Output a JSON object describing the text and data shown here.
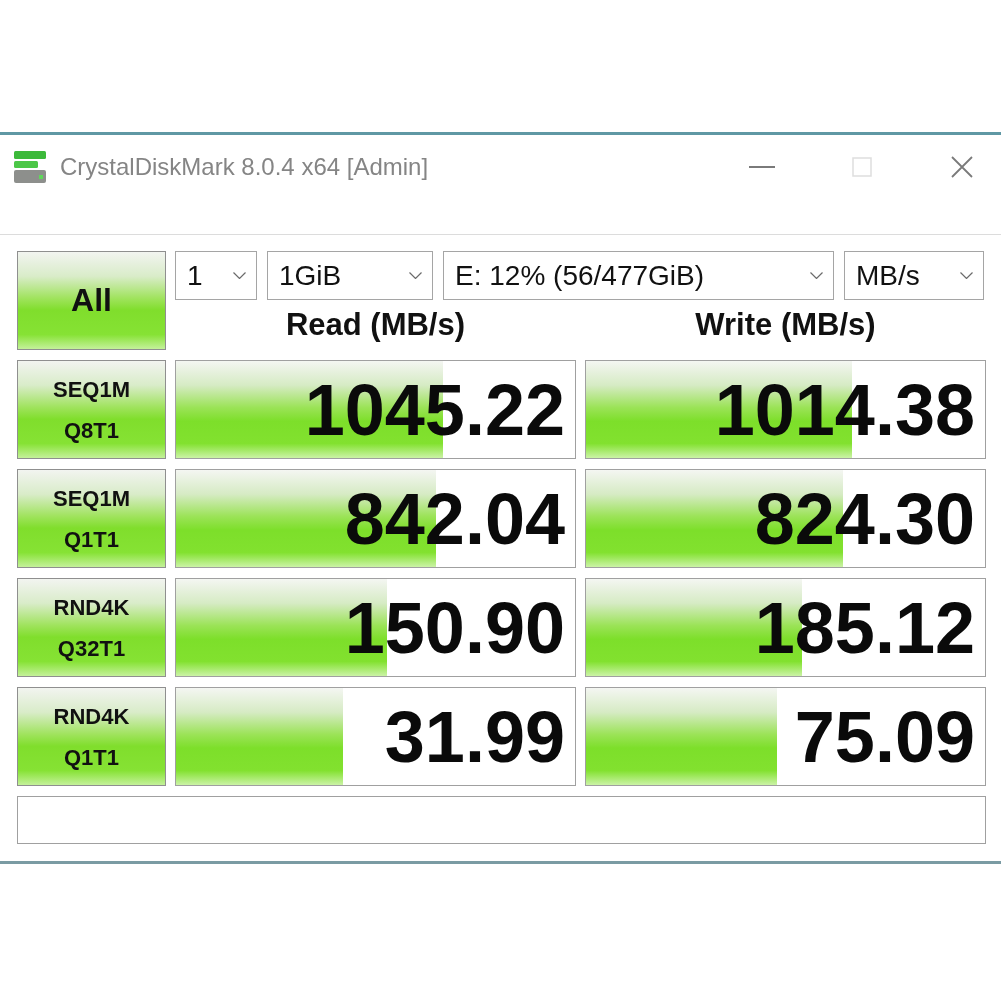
{
  "window": {
    "title": "CrystalDiskMark 8.0.4 x64 [Admin]",
    "buttons": [
      {
        "kind": "minimize",
        "disabled": false
      },
      {
        "kind": "maximize",
        "disabled": true
      },
      {
        "kind": "close",
        "disabled": false
      }
    ]
  },
  "all_button": "All",
  "selectors": [
    {
      "value": "1"
    },
    {
      "value": "1GiB"
    },
    {
      "value": "E: 12% (56/477GiB)"
    },
    {
      "value": "MB/s"
    }
  ],
  "columns": [
    "Read (MB/s)",
    "Write (MB/s)"
  ],
  "rows": [
    {
      "label": [
        "SEQ1M",
        "Q8T1"
      ],
      "results": [
        {
          "value": "1045.22",
          "level": 0.67
        },
        {
          "value": "1014.38",
          "level": 0.667
        }
      ]
    },
    {
      "label": [
        "SEQ1M",
        "Q1T1"
      ],
      "results": [
        {
          "value": "842.04",
          "level": 0.652
        },
        {
          "value": "824.30",
          "level": 0.645
        }
      ]
    },
    {
      "label": [
        "RND4K",
        "Q32T1"
      ],
      "results": [
        {
          "value": "150.90",
          "level": 0.528
        },
        {
          "value": "185.12",
          "level": 0.541
        }
      ]
    },
    {
      "label": [
        "RND4K",
        "Q1T1"
      ],
      "results": [
        {
          "value": "31.99",
          "level": 0.418
        },
        {
          "value": "75.09",
          "level": 0.479
        }
      ]
    }
  ]
}
